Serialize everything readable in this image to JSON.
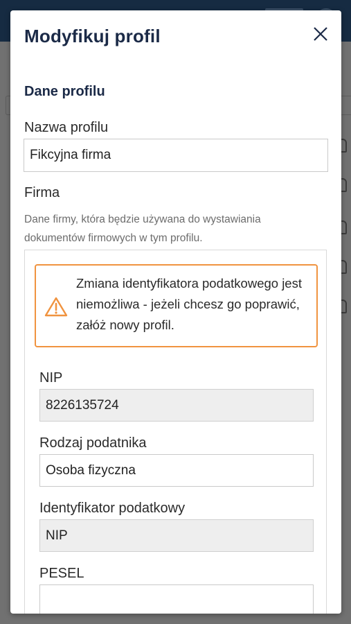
{
  "modal": {
    "title": "Modyfikuj profil",
    "close_icon": "close-icon",
    "section_title": "Dane profilu",
    "profile_name": {
      "label": "Nazwa profilu",
      "value": "Fikcyjna firma"
    },
    "company": {
      "label": "Firma",
      "help": "Dane firmy, która będzie używana do wystawiania dokumentów firmowych w tym profilu.",
      "alert": {
        "icon": "warning-icon",
        "color": "#f0933f",
        "text": "Zmiana identyfikatora podatkowego jest niemożliwa - jeżeli chcesz go poprawić, załóż nowy profil."
      },
      "fields": {
        "nip": {
          "label": "NIP",
          "value": "8226135724"
        },
        "taxpayer_type": {
          "label": "Rodzaj podatnika",
          "value": "Osoba fizyczna"
        },
        "tax_identifier": {
          "label": "Identyfikator podatkowy",
          "value": "NIP"
        },
        "pesel": {
          "label": "PESEL",
          "value": ""
        }
      }
    }
  },
  "colors": {
    "title": "#1b2a47",
    "overlay": "#5f5f5f",
    "topbar": "#162b42",
    "warning": "#f0933f"
  }
}
